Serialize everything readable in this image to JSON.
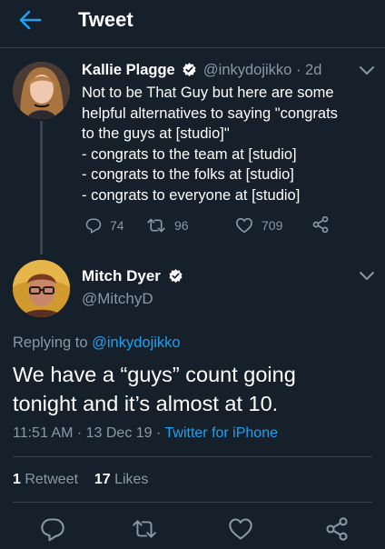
{
  "header": {
    "title": "Tweet"
  },
  "parent_tweet": {
    "name": "Kallie Plagge",
    "handle": "@inkydojikko",
    "time": "· 2d",
    "lines": [
      "Not to be That Guy but here are some",
      "helpful alternatives to saying \"congrats",
      "to the guys at [studio]\"",
      "- congrats to the team at [studio]",
      "- congrats to the folks at [studio]",
      "- congrats to everyone at [studio]"
    ],
    "replies": "74",
    "retweets": "96",
    "likes": "709"
  },
  "main_tweet": {
    "name": "Mitch Dyer",
    "handle": "@MitchyD",
    "replying_prefix": "Replying to ",
    "replying_to": "@inkydojikko",
    "lines": [
      "We have a “guys” count going",
      "tonight and it’s almost at 10."
    ],
    "timestamp": "11:51 AM · 13 Dec 19 · ",
    "client": "Twitter for iPhone",
    "retweet_count": "1",
    "retweet_label": " Retweet",
    "like_count": "17",
    "like_label": " Likes"
  },
  "colors": {
    "background": "#15202b",
    "accent": "#1da1f2",
    "secondary_text": "#8899a6",
    "divider": "#38444d"
  },
  "icons": [
    "back-arrow-icon",
    "verified-badge-icon",
    "chevron-down-icon",
    "reply-icon",
    "retweet-icon",
    "heart-icon",
    "share-icon"
  ]
}
